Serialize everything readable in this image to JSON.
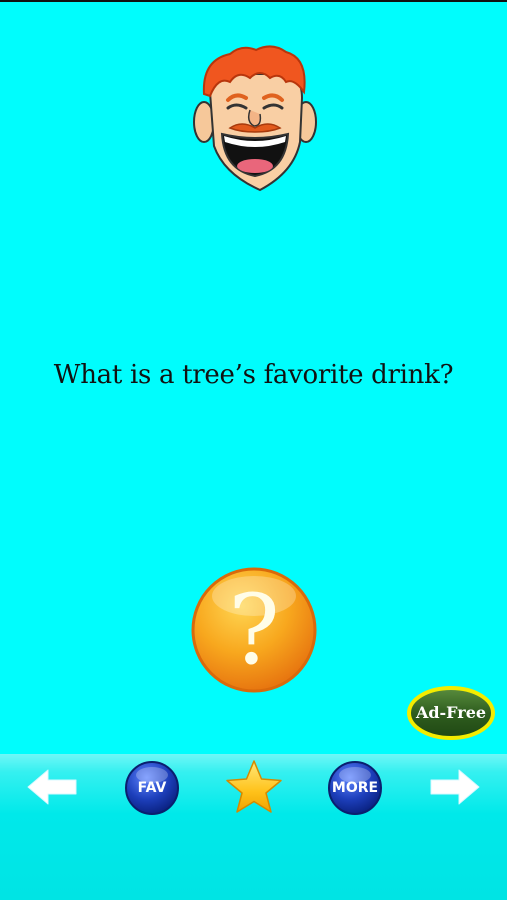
{
  "joke": {
    "question": "What is a tree’s favorite drink?",
    "reveal_symbol": "?"
  },
  "ad_free": {
    "label": "Ad-Free"
  },
  "toolbar": {
    "back_icon": "left-arrow-icon",
    "fav_label": "FAV",
    "star_icon": "star-icon",
    "more_label": "MORE",
    "next_icon": "right-arrow-icon"
  },
  "colors": {
    "background": "#00fdfd",
    "reveal_button": "#f6a01a",
    "fav_more_button": "#1a3fb8",
    "ad_free_badge": "#2f5e1f",
    "ad_free_ring": "#f3ec00",
    "star": "#ffcf1f"
  },
  "mascot": {
    "icon": "laughing-face-icon"
  }
}
